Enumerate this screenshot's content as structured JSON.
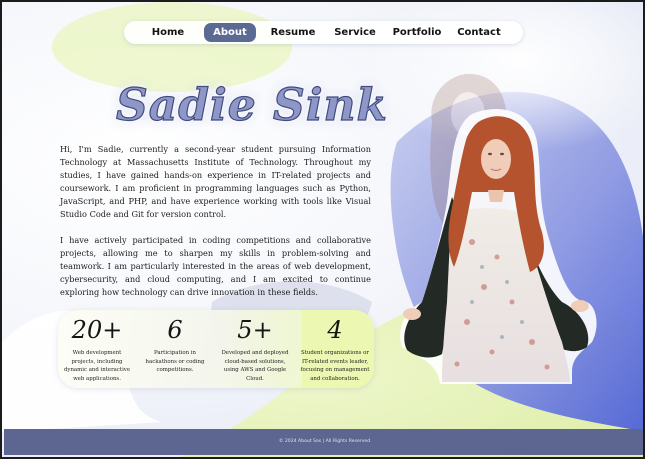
{
  "nav": {
    "items": [
      {
        "label": "Home"
      },
      {
        "label": "About"
      },
      {
        "label": "Resume"
      },
      {
        "label": "Service"
      },
      {
        "label": "Portfolio"
      },
      {
        "label": "Contact"
      }
    ],
    "active": "About"
  },
  "hero": {
    "name": "Sadie Sink"
  },
  "about": {
    "paragraph1": "Hi, I'm Sadie, currently a second-year student pursuing Information Technology at Massachusetts Institute of Technology. Throughout my studies, I have gained hands-on experience in IT-related projects and coursework. I am proficient in programming languages such as Python, JavaScript, and PHP, and have experience working with tools like Visual Studio Code and Git for version control.",
    "paragraph2": "I have actively participated in coding competitions and collaborative projects, allowing me to sharpen my skills in problem-solving and teamwork. I am particularly interested in the areas of web development, cybersecurity, and cloud computing, and I am excited to continue exploring how technology can drive innovation in these fields."
  },
  "stats": [
    {
      "number": "20+",
      "description": "Web development projects, including dynamic and interactive web applications."
    },
    {
      "number": "6",
      "description": "Participation in hackathons or coding competitions."
    },
    {
      "number": "5+",
      "description": "Developed and deployed cloud-based solutions, using AWS and Google Cloud."
    },
    {
      "number": "4",
      "description": "Student organizations or IT-related events leader, focusing on management and collaboration."
    }
  ],
  "footer": {
    "text": "© 2024 About Sas | All Rights Reserved"
  },
  "theme": {
    "accent": "#5b6a92",
    "footer_bg": "#5d6690",
    "lime": "#e4f5a8",
    "blue": "#5569d6"
  }
}
